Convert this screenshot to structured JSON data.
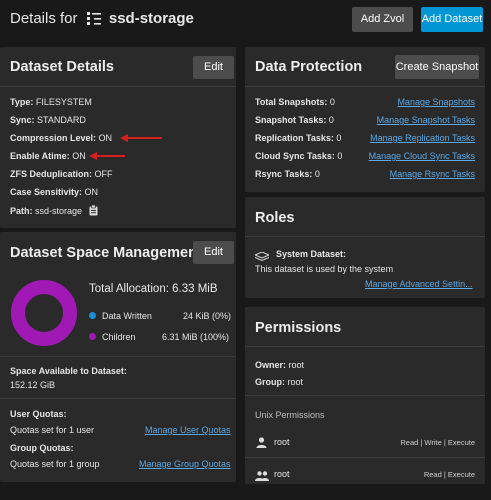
{
  "header": {
    "prefix": "Details for",
    "dataset": "ssd-storage",
    "add_zvol": "Add Zvol",
    "add_dataset": "Add Dataset"
  },
  "dataset_details": {
    "title": "Dataset Details",
    "edit": "Edit",
    "rows": [
      {
        "label": "Type:",
        "value": "FILESYSTEM"
      },
      {
        "label": "Sync:",
        "value": "STANDARD"
      },
      {
        "label": "Compression Level:",
        "value": "ON"
      },
      {
        "label": "Enable Atime:",
        "value": "ON"
      },
      {
        "label": "ZFS Deduplication:",
        "value": "OFF"
      },
      {
        "label": "Case Sensitivity:",
        "value": "ON"
      },
      {
        "label": "Path:",
        "value": "ssd-storage"
      }
    ]
  },
  "space": {
    "title": "Dataset Space Management",
    "edit": "Edit",
    "total_label": "Total Allocation:",
    "total_value": "6.33 MiB",
    "legend": [
      {
        "name": "Data Written",
        "value": "24 KiB (0%)",
        "color": "#1a8fd6"
      },
      {
        "name": "Children",
        "value": "6.31 MiB (100%)",
        "color": "#a019b5"
      }
    ],
    "available_label": "Space Available to Dataset:",
    "available_value": "152.12 GiB",
    "user_quotas_label": "User Quotas:",
    "user_quotas_value": "Quotas set for 1 user",
    "user_quotas_link": "Manage User Quotas",
    "group_quotas_label": "Group Quotas:",
    "group_quotas_value": "Quotas set for 1 group",
    "group_quotas_link": "Manage Group Quotas"
  },
  "chart_data": {
    "type": "pie",
    "categories": [
      "Data Written",
      "Children"
    ],
    "values": [
      0,
      100
    ],
    "title": ""
  },
  "protection": {
    "title": "Data Protection",
    "create_snapshot": "Create Snapshot",
    "rows": [
      {
        "label": "Total Snapshots:",
        "value": "0",
        "link": "Manage Snapshots"
      },
      {
        "label": "Snapshot Tasks:",
        "value": "0",
        "link": "Manage Snapshot Tasks"
      },
      {
        "label": "Replication Tasks:",
        "value": "0",
        "link": "Manage Replication Tasks"
      },
      {
        "label": "Cloud Sync Tasks:",
        "value": "0",
        "link": "Manage Cloud Sync Tasks"
      },
      {
        "label": "Rsync Tasks:",
        "value": "0",
        "link": "Manage Rsync Tasks"
      }
    ]
  },
  "roles": {
    "title": "Roles",
    "system_dataset_label": "System Dataset:",
    "description": "This dataset is used by the system",
    "link": "Manage Advanced Settin..."
  },
  "permissions": {
    "title": "Permissions",
    "owner_label": "Owner:",
    "owner_value": "root",
    "group_label": "Group:",
    "group_value": "root",
    "unix_label": "Unix Permissions",
    "entries": [
      {
        "name": "root",
        "perms": "Read | Write | Execute"
      },
      {
        "name": "root",
        "perms": "Read | Execute"
      }
    ]
  },
  "colors": {
    "accent": "#0095d5",
    "link": "#5aa8e6",
    "annotation_arrow": "#d42020"
  }
}
